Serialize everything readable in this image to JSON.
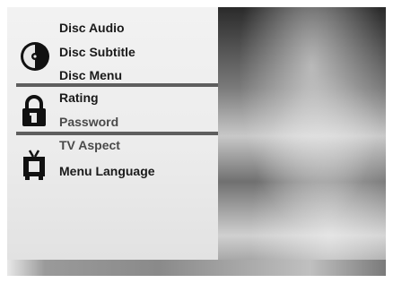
{
  "menu": {
    "disc_group": {
      "icon": "disc-icon",
      "items": [
        "Disc Audio",
        "Disc Subtitle",
        "Disc Menu"
      ]
    },
    "lock_group": {
      "icon": "padlock-icon",
      "items": [
        "Rating",
        "Password"
      ]
    },
    "tv_group": {
      "icon": "tv-icon",
      "items": [
        "TV Aspect",
        "Menu Language"
      ]
    }
  }
}
